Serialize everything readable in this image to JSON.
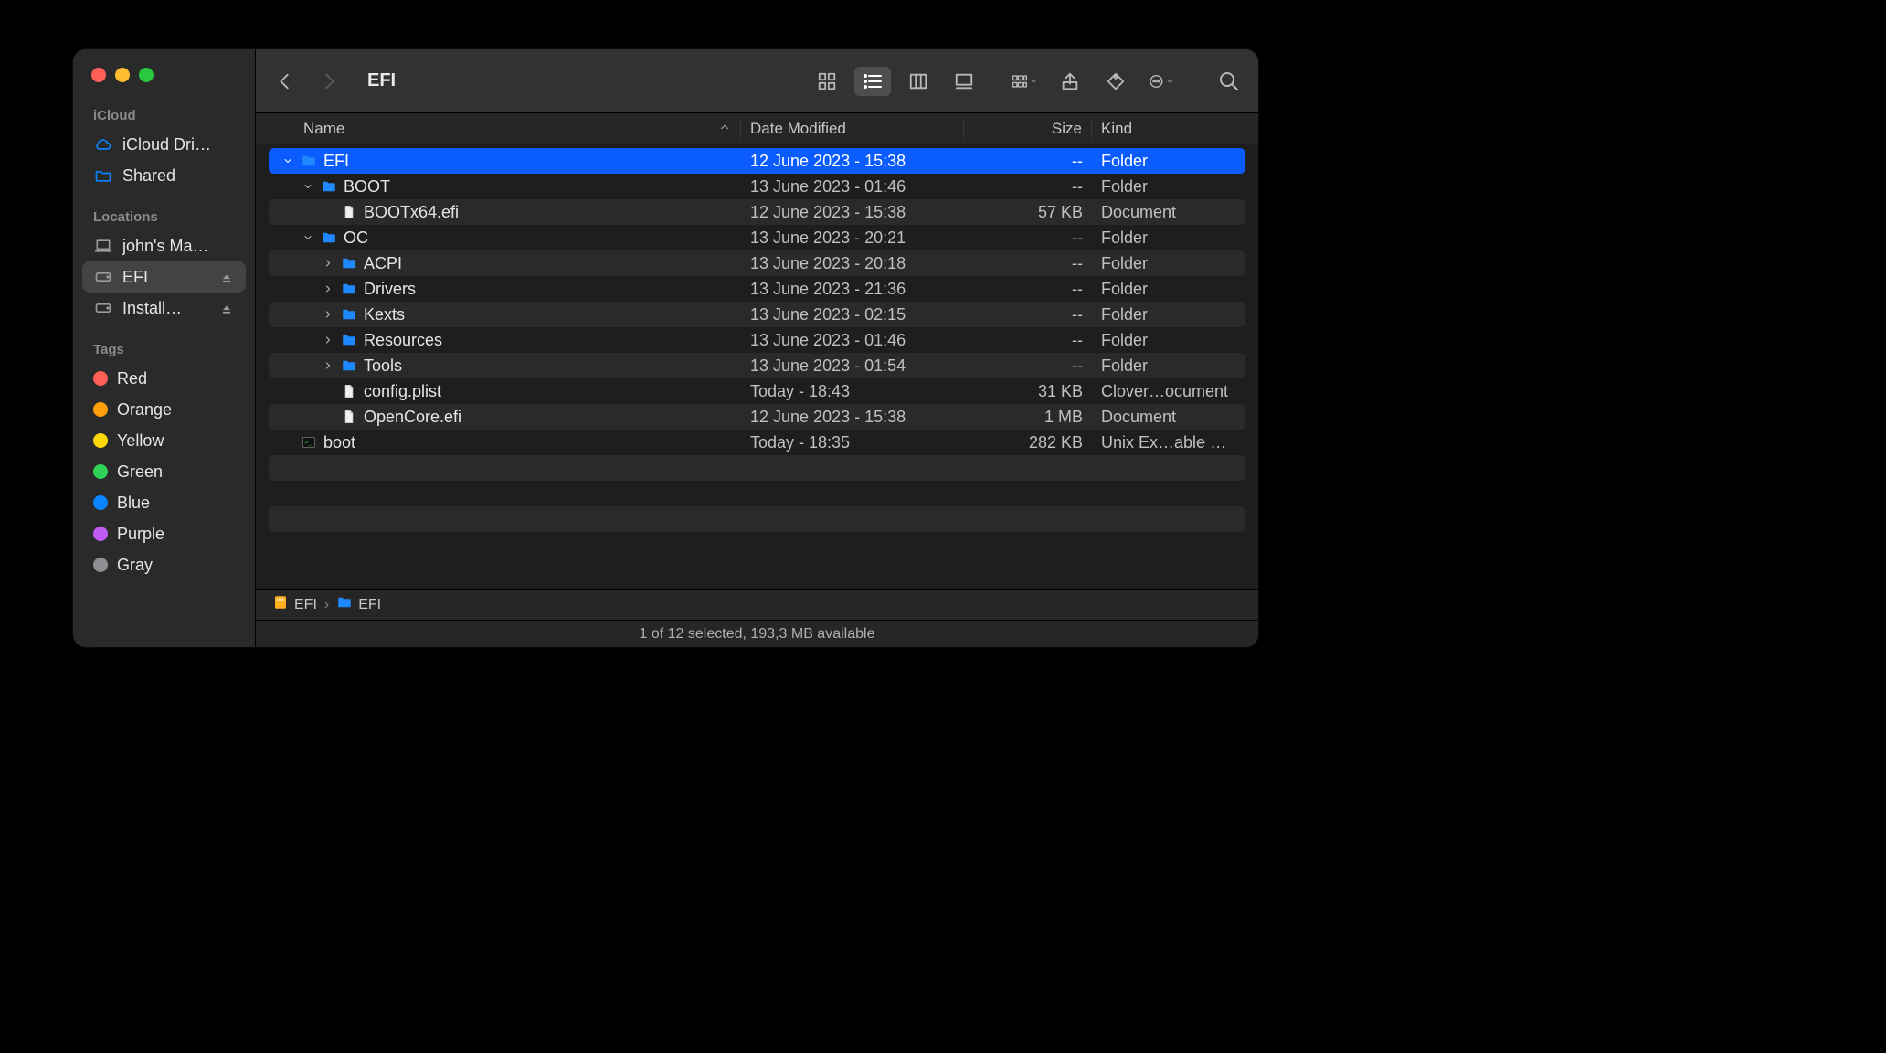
{
  "window": {
    "title": "EFI"
  },
  "sidebar": {
    "sections": [
      {
        "heading": "iCloud",
        "items": [
          {
            "label": "iCloud Dri…",
            "icon": "cloud",
            "selected": false,
            "eject": false
          },
          {
            "label": "Shared",
            "icon": "shared-folder",
            "selected": false,
            "eject": false
          }
        ]
      },
      {
        "heading": "Locations",
        "items": [
          {
            "label": "john's Ma…",
            "icon": "laptop",
            "selected": false,
            "eject": false,
            "gray": true
          },
          {
            "label": "EFI",
            "icon": "disk",
            "selected": true,
            "eject": true,
            "gray": true
          },
          {
            "label": "Install…",
            "icon": "disk",
            "selected": false,
            "eject": true,
            "gray": true
          }
        ]
      },
      {
        "heading": "Tags",
        "items": [
          {
            "label": "Red",
            "tag": "#ff5f57"
          },
          {
            "label": "Orange",
            "tag": "#ff9f0a"
          },
          {
            "label": "Yellow",
            "tag": "#ffd60a"
          },
          {
            "label": "Green",
            "tag": "#30d158"
          },
          {
            "label": "Blue",
            "tag": "#0a84ff"
          },
          {
            "label": "Purple",
            "tag": "#bf5af2"
          },
          {
            "label": "Gray",
            "tag": "#8e8e93"
          }
        ]
      }
    ]
  },
  "columns": {
    "name": "Name",
    "date": "Date Modified",
    "size": "Size",
    "kind": "Kind"
  },
  "rows": [
    {
      "indent": 0,
      "disclosure": "down",
      "icon": "folder",
      "name": "EFI",
      "date": "12 June 2023 - 15:38",
      "size": "--",
      "kind": "Folder",
      "selected": true
    },
    {
      "indent": 1,
      "disclosure": "down",
      "icon": "folder",
      "name": "BOOT",
      "date": "13 June 2023 - 01:46",
      "size": "--",
      "kind": "Folder"
    },
    {
      "indent": 2,
      "disclosure": "none",
      "icon": "file",
      "name": "BOOTx64.efi",
      "date": "12 June 2023 - 15:38",
      "size": "57 KB",
      "kind": "Document"
    },
    {
      "indent": 1,
      "disclosure": "down",
      "icon": "folder",
      "name": "OC",
      "date": "13 June 2023 - 20:21",
      "size": "--",
      "kind": "Folder"
    },
    {
      "indent": 2,
      "disclosure": "right",
      "icon": "folder",
      "name": "ACPI",
      "date": "13 June 2023 - 20:18",
      "size": "--",
      "kind": "Folder"
    },
    {
      "indent": 2,
      "disclosure": "right",
      "icon": "folder",
      "name": "Drivers",
      "date": "13 June 2023 - 21:36",
      "size": "--",
      "kind": "Folder"
    },
    {
      "indent": 2,
      "disclosure": "right",
      "icon": "folder",
      "name": "Kexts",
      "date": "13 June 2023 - 02:15",
      "size": "--",
      "kind": "Folder"
    },
    {
      "indent": 2,
      "disclosure": "right",
      "icon": "folder",
      "name": "Resources",
      "date": "13 June 2023 - 01:46",
      "size": "--",
      "kind": "Folder"
    },
    {
      "indent": 2,
      "disclosure": "right",
      "icon": "folder",
      "name": "Tools",
      "date": "13 June 2023 - 01:54",
      "size": "--",
      "kind": "Folder"
    },
    {
      "indent": 2,
      "disclosure": "none",
      "icon": "file",
      "name": "config.plist",
      "date": "Today - 18:43",
      "size": "31 KB",
      "kind": "Clover…ocument"
    },
    {
      "indent": 2,
      "disclosure": "none",
      "icon": "file",
      "name": "OpenCore.efi",
      "date": "12 June 2023 - 15:38",
      "size": "1 MB",
      "kind": "Document"
    },
    {
      "indent": 0,
      "disclosure": "none",
      "icon": "exec",
      "name": "boot",
      "date": "Today - 18:35",
      "size": "282 KB",
      "kind": "Unix Ex…able File"
    }
  ],
  "path": [
    {
      "icon": "volume",
      "label": "EFI"
    },
    {
      "icon": "folder",
      "label": "EFI"
    }
  ],
  "status": "1 of 12 selected, 193,3 MB available"
}
